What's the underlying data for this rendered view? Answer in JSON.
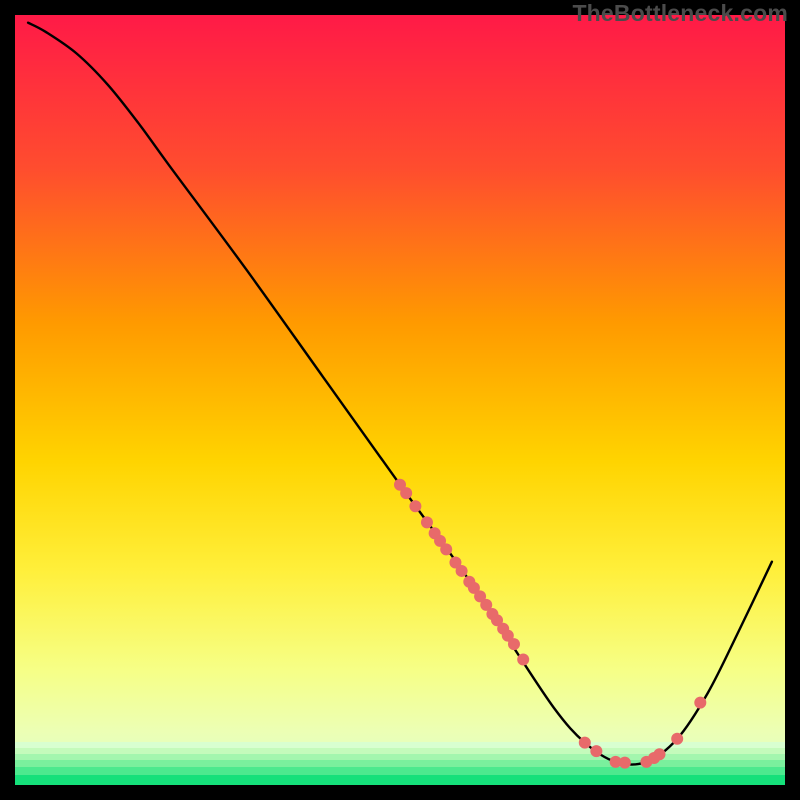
{
  "watermark": "TheBottleneck.com",
  "chart_data": {
    "type": "line",
    "title": "",
    "xlabel": "",
    "ylabel": "",
    "xlim": [
      0,
      100
    ],
    "ylim": [
      0,
      100
    ],
    "grid": false,
    "legend": false,
    "background_gradient": {
      "top": "#ff1a47",
      "mid_upper": "#ff8a00",
      "mid": "#ffe600",
      "lower": "#f6ff7a",
      "bottom_band": "#15e07a"
    },
    "curve": {
      "description": "Black curve starting near top-left, descending diagonally to a flat minimum near x≈80, then rising to the right edge.",
      "points": [
        {
          "x": 1.7,
          "y": 99.0
        },
        {
          "x": 4.0,
          "y": 97.8
        },
        {
          "x": 8.0,
          "y": 95.0
        },
        {
          "x": 12.0,
          "y": 91.0
        },
        {
          "x": 16.0,
          "y": 86.0
        },
        {
          "x": 20.0,
          "y": 80.5
        },
        {
          "x": 30.0,
          "y": 67.0
        },
        {
          "x": 40.0,
          "y": 53.0
        },
        {
          "x": 50.0,
          "y": 39.0
        },
        {
          "x": 58.0,
          "y": 28.0
        },
        {
          "x": 64.0,
          "y": 19.0
        },
        {
          "x": 70.0,
          "y": 10.0
        },
        {
          "x": 74.0,
          "y": 5.5
        },
        {
          "x": 78.0,
          "y": 3.0
        },
        {
          "x": 82.0,
          "y": 3.0
        },
        {
          "x": 86.0,
          "y": 6.0
        },
        {
          "x": 90.0,
          "y": 12.0
        },
        {
          "x": 94.0,
          "y": 20.0
        },
        {
          "x": 98.3,
          "y": 29.0
        }
      ]
    },
    "dots": {
      "color": "#e86a6a",
      "radius_px": 6,
      "points": [
        {
          "x": 50.0,
          "y": 39.0
        },
        {
          "x": 50.8,
          "y": 37.9
        },
        {
          "x": 52.0,
          "y": 36.2
        },
        {
          "x": 53.5,
          "y": 34.1
        },
        {
          "x": 54.5,
          "y": 32.7
        },
        {
          "x": 55.2,
          "y": 31.7
        },
        {
          "x": 56.0,
          "y": 30.6
        },
        {
          "x": 57.2,
          "y": 28.9
        },
        {
          "x": 58.0,
          "y": 27.8
        },
        {
          "x": 59.0,
          "y": 26.4
        },
        {
          "x": 59.6,
          "y": 25.6
        },
        {
          "x": 60.4,
          "y": 24.5
        },
        {
          "x": 61.2,
          "y": 23.4
        },
        {
          "x": 62.0,
          "y": 22.2
        },
        {
          "x": 62.6,
          "y": 21.4
        },
        {
          "x": 63.4,
          "y": 20.3
        },
        {
          "x": 64.0,
          "y": 19.4
        },
        {
          "x": 64.8,
          "y": 18.3
        },
        {
          "x": 66.0,
          "y": 16.3
        },
        {
          "x": 74.0,
          "y": 5.5
        },
        {
          "x": 75.5,
          "y": 4.4
        },
        {
          "x": 78.0,
          "y": 3.0
        },
        {
          "x": 79.2,
          "y": 2.9
        },
        {
          "x": 82.0,
          "y": 3.0
        },
        {
          "x": 83.0,
          "y": 3.5
        },
        {
          "x": 83.7,
          "y": 4.0
        },
        {
          "x": 86.0,
          "y": 6.0
        },
        {
          "x": 89.0,
          "y": 10.7
        }
      ]
    },
    "bottom_bands_y": [
      0,
      1.0,
      2.0,
      3.0,
      4.0,
      5.0
    ]
  }
}
